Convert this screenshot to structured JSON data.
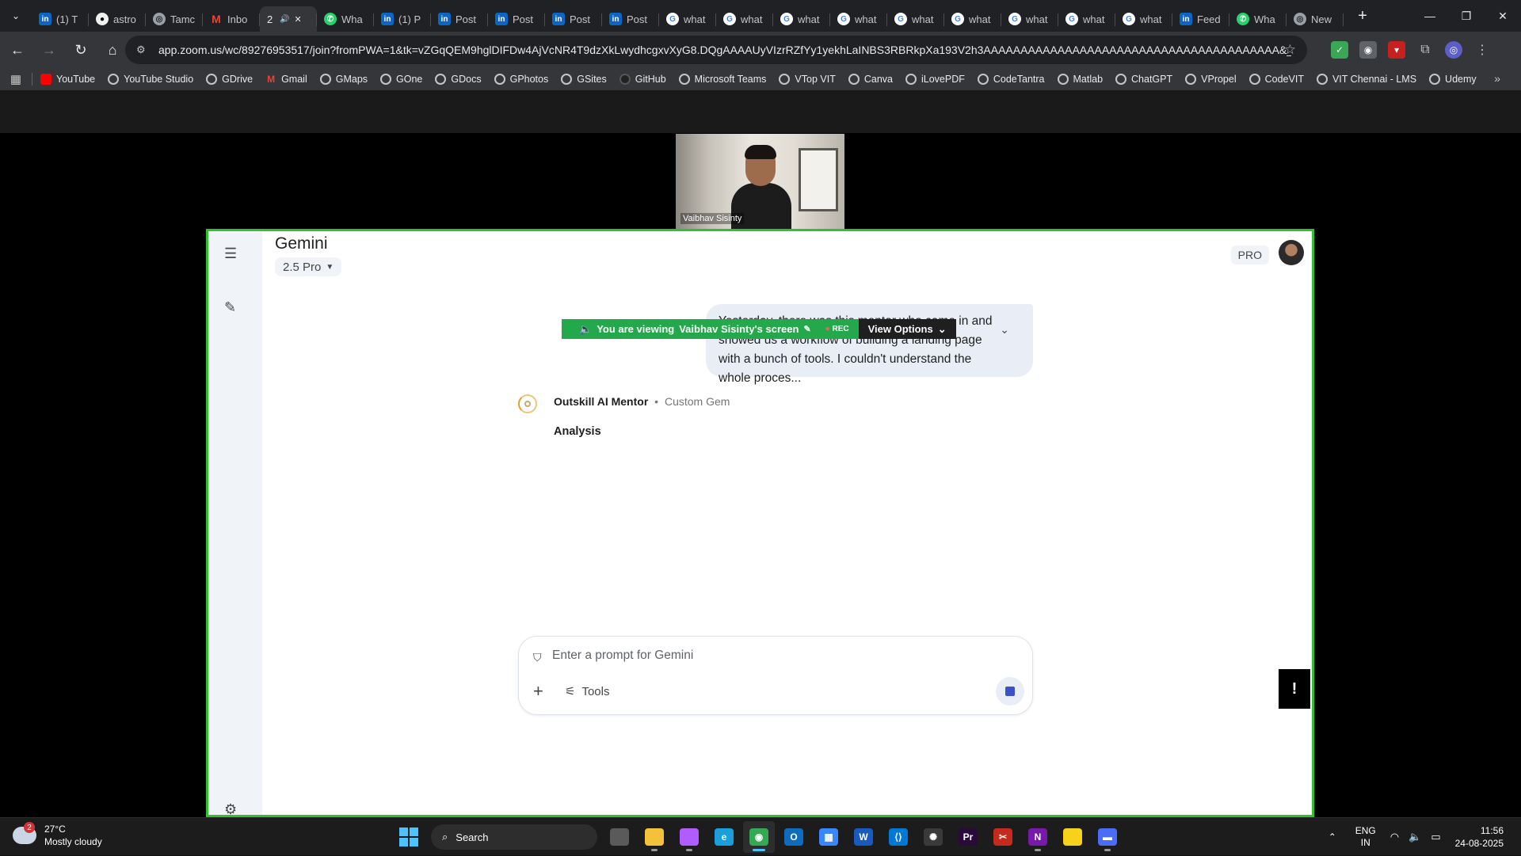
{
  "browser": {
    "tabs": [
      {
        "label": "(1) T",
        "icon": "linkedin-icon",
        "fav": "li",
        "favtext": "in"
      },
      {
        "label": "astro",
        "icon": "github-icon",
        "fav": "gh",
        "favtext": "●"
      },
      {
        "label": "Tamc",
        "icon": "chrome-site-icon",
        "fav": "ch",
        "favtext": "◎"
      },
      {
        "label": "Inbo",
        "icon": "gmail-icon",
        "fav": "gm",
        "favtext": "M"
      },
      {
        "label": "2",
        "icon": "audio-icon",
        "fav": "none",
        "favtext": "",
        "active": true
      },
      {
        "label": "Wha",
        "icon": "whatsapp-icon",
        "fav": "wa",
        "favtext": "✆"
      },
      {
        "label": "(1) P",
        "icon": "linkedin-icon",
        "fav": "li",
        "favtext": "in"
      },
      {
        "label": "Post",
        "icon": "linkedin-icon",
        "fav": "li",
        "favtext": "in"
      },
      {
        "label": "Post",
        "icon": "linkedin-icon",
        "fav": "li",
        "favtext": "in"
      },
      {
        "label": "Post",
        "icon": "linkedin-icon",
        "fav": "li",
        "favtext": "in"
      },
      {
        "label": "Post",
        "icon": "linkedin-icon",
        "fav": "li",
        "favtext": "in"
      },
      {
        "label": "what",
        "icon": "google-icon",
        "fav": "gg",
        "favtext": "G"
      },
      {
        "label": "what",
        "icon": "google-icon",
        "fav": "gg",
        "favtext": "G"
      },
      {
        "label": "what",
        "icon": "google-icon",
        "fav": "gg",
        "favtext": "G"
      },
      {
        "label": "what",
        "icon": "google-icon",
        "fav": "gg",
        "favtext": "G"
      },
      {
        "label": "what",
        "icon": "google-icon",
        "fav": "gg",
        "favtext": "G"
      },
      {
        "label": "what",
        "icon": "google-icon",
        "fav": "gg",
        "favtext": "G"
      },
      {
        "label": "what",
        "icon": "google-icon",
        "fav": "gg",
        "favtext": "G"
      },
      {
        "label": "what",
        "icon": "google-icon",
        "fav": "gg",
        "favtext": "G"
      },
      {
        "label": "what",
        "icon": "google-icon",
        "fav": "gg",
        "favtext": "G"
      },
      {
        "label": "Feed",
        "icon": "linkedin-icon",
        "fav": "li",
        "favtext": "in"
      },
      {
        "label": "Wha",
        "icon": "whatsapp-icon",
        "fav": "wa",
        "favtext": "✆"
      },
      {
        "label": "New",
        "icon": "chrome-site-icon",
        "fav": "ch",
        "favtext": "◎"
      }
    ],
    "url_host": "app.zoom.us",
    "url_rest": "/wc/89276953517/join?fromPWA=1&tk=vZGqQEM9hglDIFDw4AjVcNR4T9dzXkLwydhcgxvXyG8.DQgAAAAUyVIzrRZfYy1yekhLaINBS3RBRkpXa193V2h3AAAAAAAAAAAAAAAAAAAAAAAAAAAAAAAAAAAAAAAA&_x_zm_r...",
    "bookmarks": [
      {
        "label": "YouTube",
        "type": "yt"
      },
      {
        "label": "YouTube Studio",
        "type": "g"
      },
      {
        "label": "GDrive",
        "type": "g"
      },
      {
        "label": "Gmail",
        "type": "gm"
      },
      {
        "label": "GMaps",
        "type": "g"
      },
      {
        "label": "GOne",
        "type": "g"
      },
      {
        "label": "GDocs",
        "type": "g"
      },
      {
        "label": "GPhotos",
        "type": "g"
      },
      {
        "label": "GSites",
        "type": "g"
      },
      {
        "label": "GitHub",
        "type": "gh"
      },
      {
        "label": "Microsoft Teams",
        "type": "g"
      },
      {
        "label": "VTop VIT",
        "type": "g"
      },
      {
        "label": "Canva",
        "type": "g"
      },
      {
        "label": "iLovePDF",
        "type": "g"
      },
      {
        "label": "CodeTantra",
        "type": "g"
      },
      {
        "label": "Matlab",
        "type": "g"
      },
      {
        "label": "ChatGPT",
        "type": "g"
      },
      {
        "label": "VPropel",
        "type": "g"
      },
      {
        "label": "CodeVIT",
        "type": "g"
      },
      {
        "label": "VIT Chennai - LMS",
        "type": "g"
      },
      {
        "label": "Udemy",
        "type": "g"
      }
    ]
  },
  "zoom": {
    "participant_name": "Vaibhav Sisinty",
    "banner_prefix": "You are viewing",
    "banner_screen": "Vaibhav Sisinty's screen",
    "rec_label": "REC",
    "view_options": "View Options",
    "share_border_color": "#30c030"
  },
  "gemini": {
    "title": "Gemini",
    "model": "2.5 Pro",
    "pro_badge": "PRO",
    "user_message": "Yesterday, there was this mentor who came in and showed us a workflow of building a landing page with a bunch of tools. I couldn't understand the whole proces...",
    "bot_name": "Outskill AI Mentor",
    "bot_sep": "•",
    "bot_tag": "Custom Gem",
    "status": "Analysis",
    "input_placeholder": "Enter a prompt for Gemini",
    "tools_label": "Tools"
  },
  "taskbar": {
    "weather_temp": "27°C",
    "weather_desc": "Mostly cloudy",
    "weather_badge": "2",
    "search_label": "Search",
    "lang_top": "ENG",
    "lang_bottom": "IN",
    "time": "11:56",
    "date": "24-08-2025",
    "apps": [
      {
        "name": "task-view-app",
        "color": "#5a5a5a",
        "glyph": ""
      },
      {
        "name": "file-explorer-app",
        "color": "#f3c13a",
        "glyph": ""
      },
      {
        "name": "copilot-app",
        "color": "#b05cff",
        "glyph": ""
      },
      {
        "name": "edge-app",
        "color": "#1a9fdb",
        "glyph": "e"
      },
      {
        "name": "chrome-app",
        "color": "#34a853",
        "glyph": "◉",
        "active": true
      },
      {
        "name": "outlook-app",
        "color": "#0f6cbd",
        "glyph": "O"
      },
      {
        "name": "store-app",
        "color": "#3a86ff",
        "glyph": "▦"
      },
      {
        "name": "word-app",
        "color": "#185abd",
        "glyph": "W"
      },
      {
        "name": "vscode-app",
        "color": "#0078d4",
        "glyph": "⟨⟩"
      },
      {
        "name": "openai-app",
        "color": "#3a3a3a",
        "glyph": "✺"
      },
      {
        "name": "premiere-app",
        "color": "#2a0a3a",
        "glyph": "Pr"
      },
      {
        "name": "snipping-app",
        "color": "#c42b1c",
        "glyph": "✂"
      },
      {
        "name": "onenote-app",
        "color": "#7719aa",
        "glyph": "N"
      },
      {
        "name": "sticky-notes-app",
        "color": "#f7d21b",
        "glyph": ""
      },
      {
        "name": "zoom-app",
        "color": "#4a6cf7",
        "glyph": "▬"
      }
    ]
  }
}
